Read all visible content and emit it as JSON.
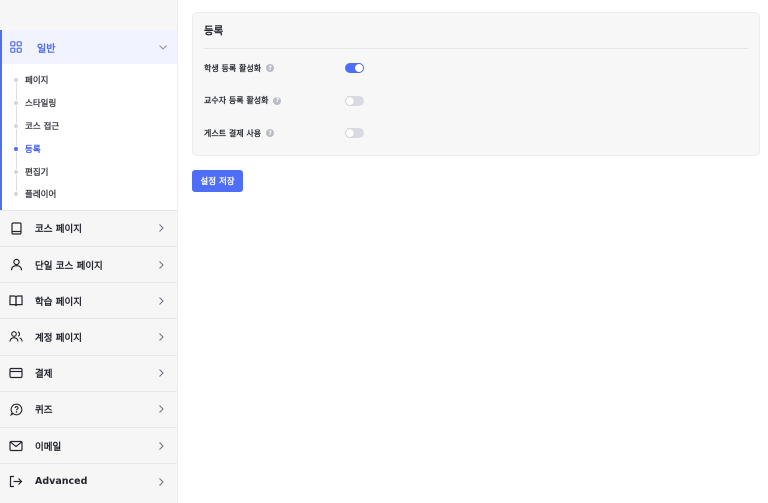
{
  "sidebar": {
    "open_group": {
      "label": "일반",
      "icon": "grid-icon",
      "subitems": [
        {
          "label": "페이지",
          "active": false
        },
        {
          "label": "스타일링",
          "active": false
        },
        {
          "label": "코스 접근",
          "active": false
        },
        {
          "label": "등록",
          "active": true
        },
        {
          "label": "편집기",
          "active": false
        },
        {
          "label": "플레이어",
          "active": false
        }
      ]
    },
    "items": [
      {
        "label": "코스 페이지",
        "icon": "book-icon"
      },
      {
        "label": "단일 코스 페이지",
        "icon": "user-icon"
      },
      {
        "label": "학습 페이지",
        "icon": "open-book-icon"
      },
      {
        "label": "계정 페이지",
        "icon": "users-icon"
      },
      {
        "label": "결제",
        "icon": "credit-card-icon"
      },
      {
        "label": "퀴즈",
        "icon": "question-bubble-icon"
      },
      {
        "label": "이메일",
        "icon": "mail-icon"
      },
      {
        "label": "Advanced",
        "icon": "logout-icon"
      }
    ]
  },
  "main": {
    "card_title": "등록",
    "settings": [
      {
        "label": "학생 등록 활성화",
        "enabled": true
      },
      {
        "label": "교수자 등록 활성화",
        "enabled": false
      },
      {
        "label": "게스트 결제 사용",
        "enabled": false
      }
    ],
    "help_glyph": "?",
    "save_label": "설정 저장"
  },
  "colors": {
    "accent": "#4f6ef7",
    "sidebar_bg": "#f6f6f7",
    "toggle_off": "#d9dbe0"
  }
}
